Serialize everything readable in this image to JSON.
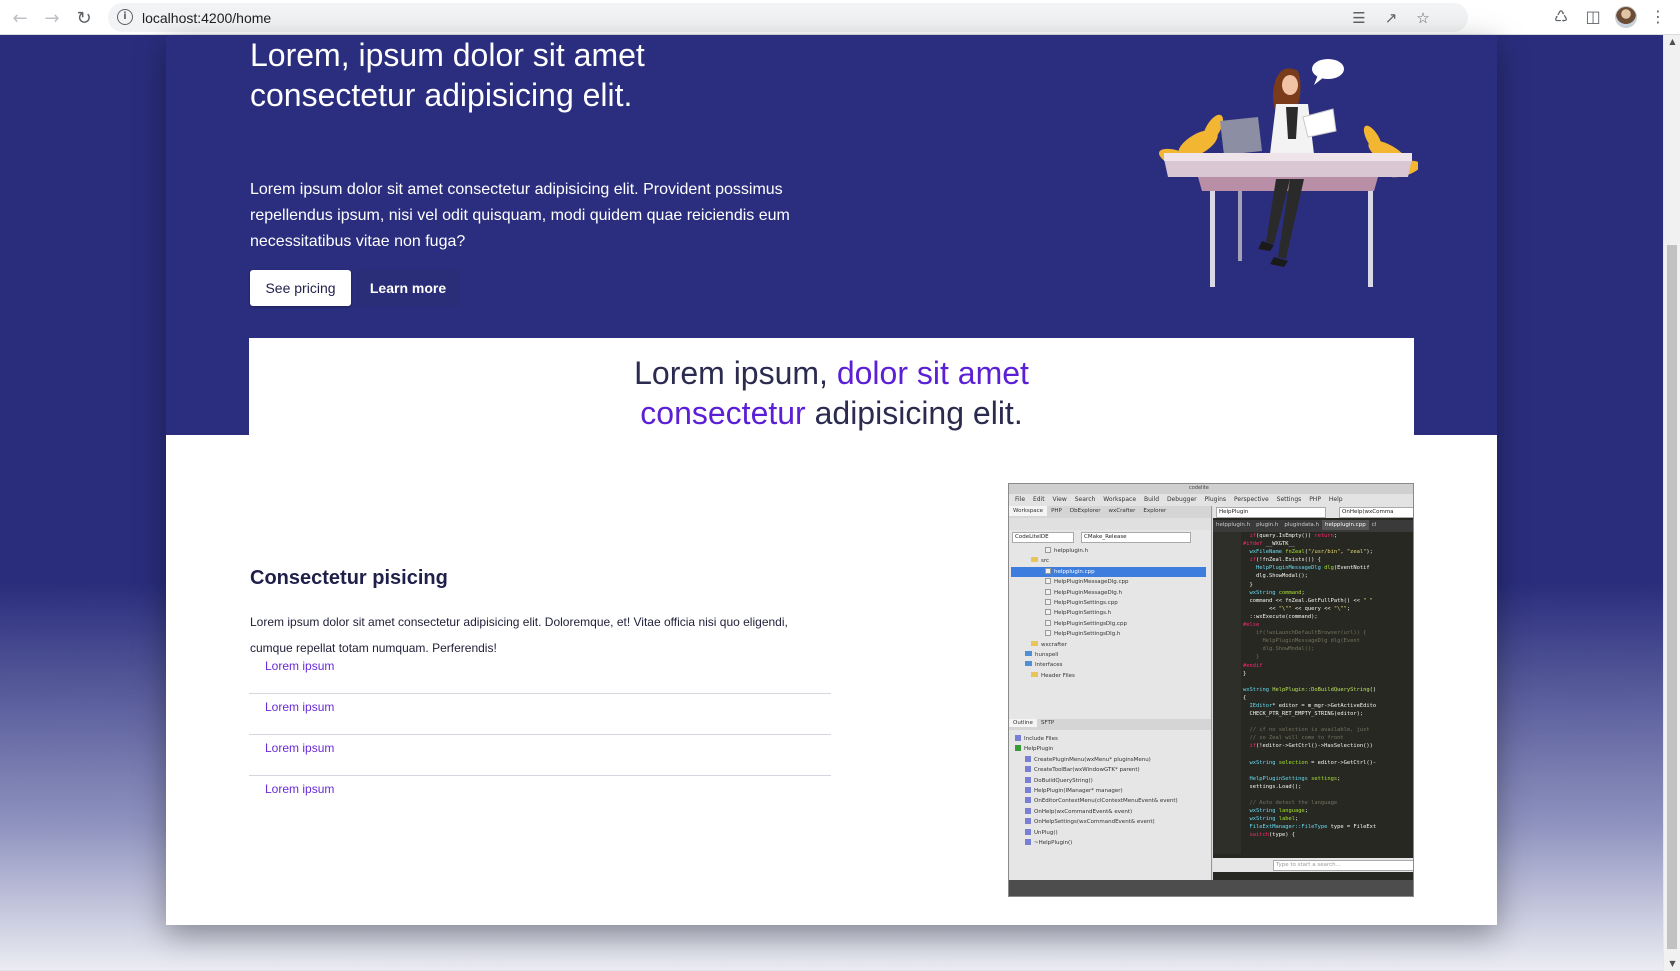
{
  "browser": {
    "url": "localhost:4200/home",
    "back_icon": "arrow-left",
    "forward_icon": "arrow-right",
    "reload_icon": "reload",
    "toolbar_icons": [
      "translate-icon",
      "share-icon",
      "star-icon",
      "extensions-icon",
      "sidepanel-icon",
      "avatar",
      "menu-icon"
    ]
  },
  "hero": {
    "title": "Lorem, ipsum dolor sit amet consectetur adipisicing elit.",
    "text": "Lorem ipsum dolor sit amet consectetur adipisicing elit. Provident possimus repellendus ipsum, nisi vel odit quisquam, modi quidem quae reiciendis eum necessitatibus vitae non fuga?",
    "primary_button": "See pricing",
    "secondary_button": "Learn more"
  },
  "banner": {
    "part1": "Lorem ipsum, ",
    "accent1": "dolor sit amet",
    "accent2": "consectetur",
    "part2": " adipisicing elit."
  },
  "feature": {
    "title": "Consectetur pisicing",
    "text": "Lorem ipsum dolor sit amet consectetur adipisicing elit. Doloremque, et! Vitae officia nisi quo eligendi, cumque repellat totam numquam. Perferendis!",
    "links": [
      "Lorem ipsum",
      "Lorem ipsum",
      "Lorem ipsum",
      "Lorem ipsum"
    ]
  },
  "colors": {
    "hero_bg": "#2b2e7e",
    "accent": "#5b1fd6",
    "link": "#6a2bd8"
  },
  "ide": {
    "menus": [
      "File",
      "Edit",
      "View",
      "Search",
      "Workspace",
      "Build",
      "Debugger",
      "Plugins",
      "Perspective",
      "Settings",
      "PHP",
      "Help"
    ],
    "left_tabs": [
      "Workspace",
      "PHP",
      "DbExplorer",
      "wxCrafter",
      "Explorer"
    ],
    "combo_workspace": "CodeLiteIDE",
    "combo_config": "CMake_Release",
    "combo_project": "HelpPlugin",
    "combo_function": "OnHelp(wxComma",
    "tree": [
      "helpplugin.h",
      "src",
      "helpplugin.cpp",
      "HelpPluginMessageDlg.cpp",
      "HelpPluginMessageDlg.h",
      "HelpPluginSettings.cpp",
      "HelpPluginSettings.h",
      "HelpPluginSettingsDlg.cpp",
      "HelpPluginSettingsDlg.h",
      "wxcrafter",
      "hunspell",
      "Interfaces",
      "Header Files"
    ],
    "outline_tabs": [
      "Outline",
      "SFTP"
    ],
    "outline": [
      "Include Files",
      "HelpPlugin",
      "CreatePluginMenu(wxMenu* pluginsMenu)",
      "CreateToolBar(wxWindowGTK* parent)",
      "DoBuildQueryString()",
      "HelpPlugin(IManager* manager)",
      "OnEditorContextMenu(clContextMenuEvent& event)",
      "OnHelp(wxCommandEvent& event)",
      "OnHelpSettings(wxCommandEvent& event)",
      "UnPlug()",
      "~HelpPlugin()"
    ],
    "editor_tabs": [
      "helpplugin.h",
      "plugin.h",
      "plugindata.h",
      "helpplugin.cpp",
      "cl"
    ],
    "search_placeholder": "Type to start a search..."
  }
}
